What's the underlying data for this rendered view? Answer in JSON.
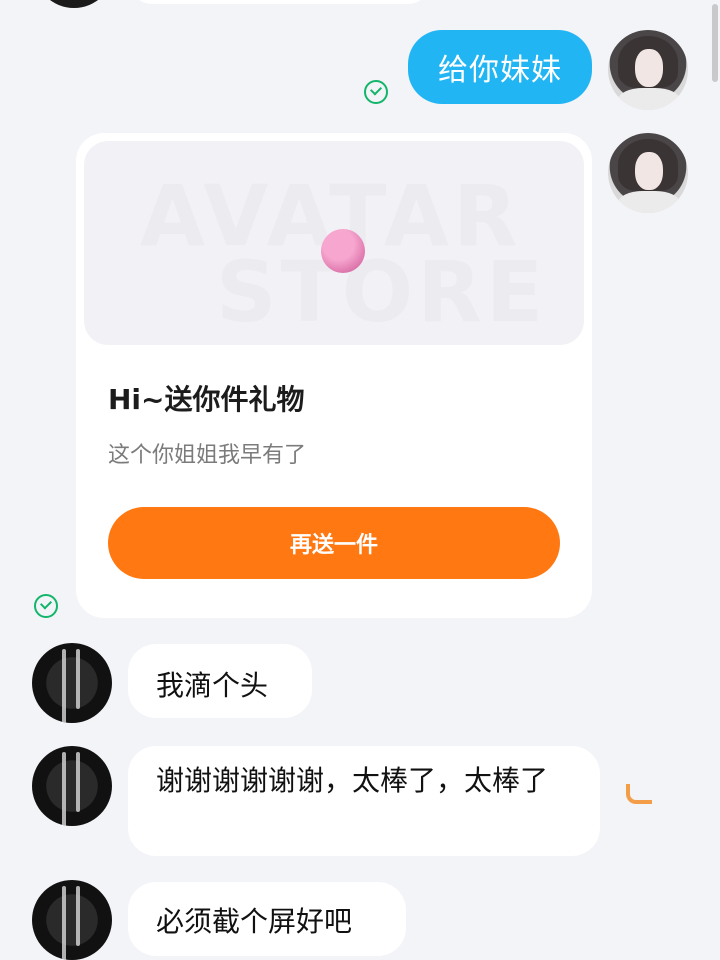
{
  "messages": {
    "outgoing_text": "给你妹妹",
    "gift_card": {
      "banner_watermark_line1": "AVATAR",
      "banner_watermark_line2": "STORE",
      "title": "Hi~送你件礼物",
      "subtitle": "这个你姐姐我早有了",
      "button_label": "再送一件"
    },
    "incoming": [
      {
        "text": "我滴个头"
      },
      {
        "text": "谢谢谢谢谢谢，太棒了，太棒了"
      },
      {
        "text": "必须截个屏好吧"
      }
    ]
  },
  "colors": {
    "outgoing_bubble": "#22b5f4",
    "button": "#ff7811",
    "read_check": "#12b56b",
    "background": "#f3f4f8"
  },
  "icons": {
    "read_check": "check-circle-icon"
  }
}
